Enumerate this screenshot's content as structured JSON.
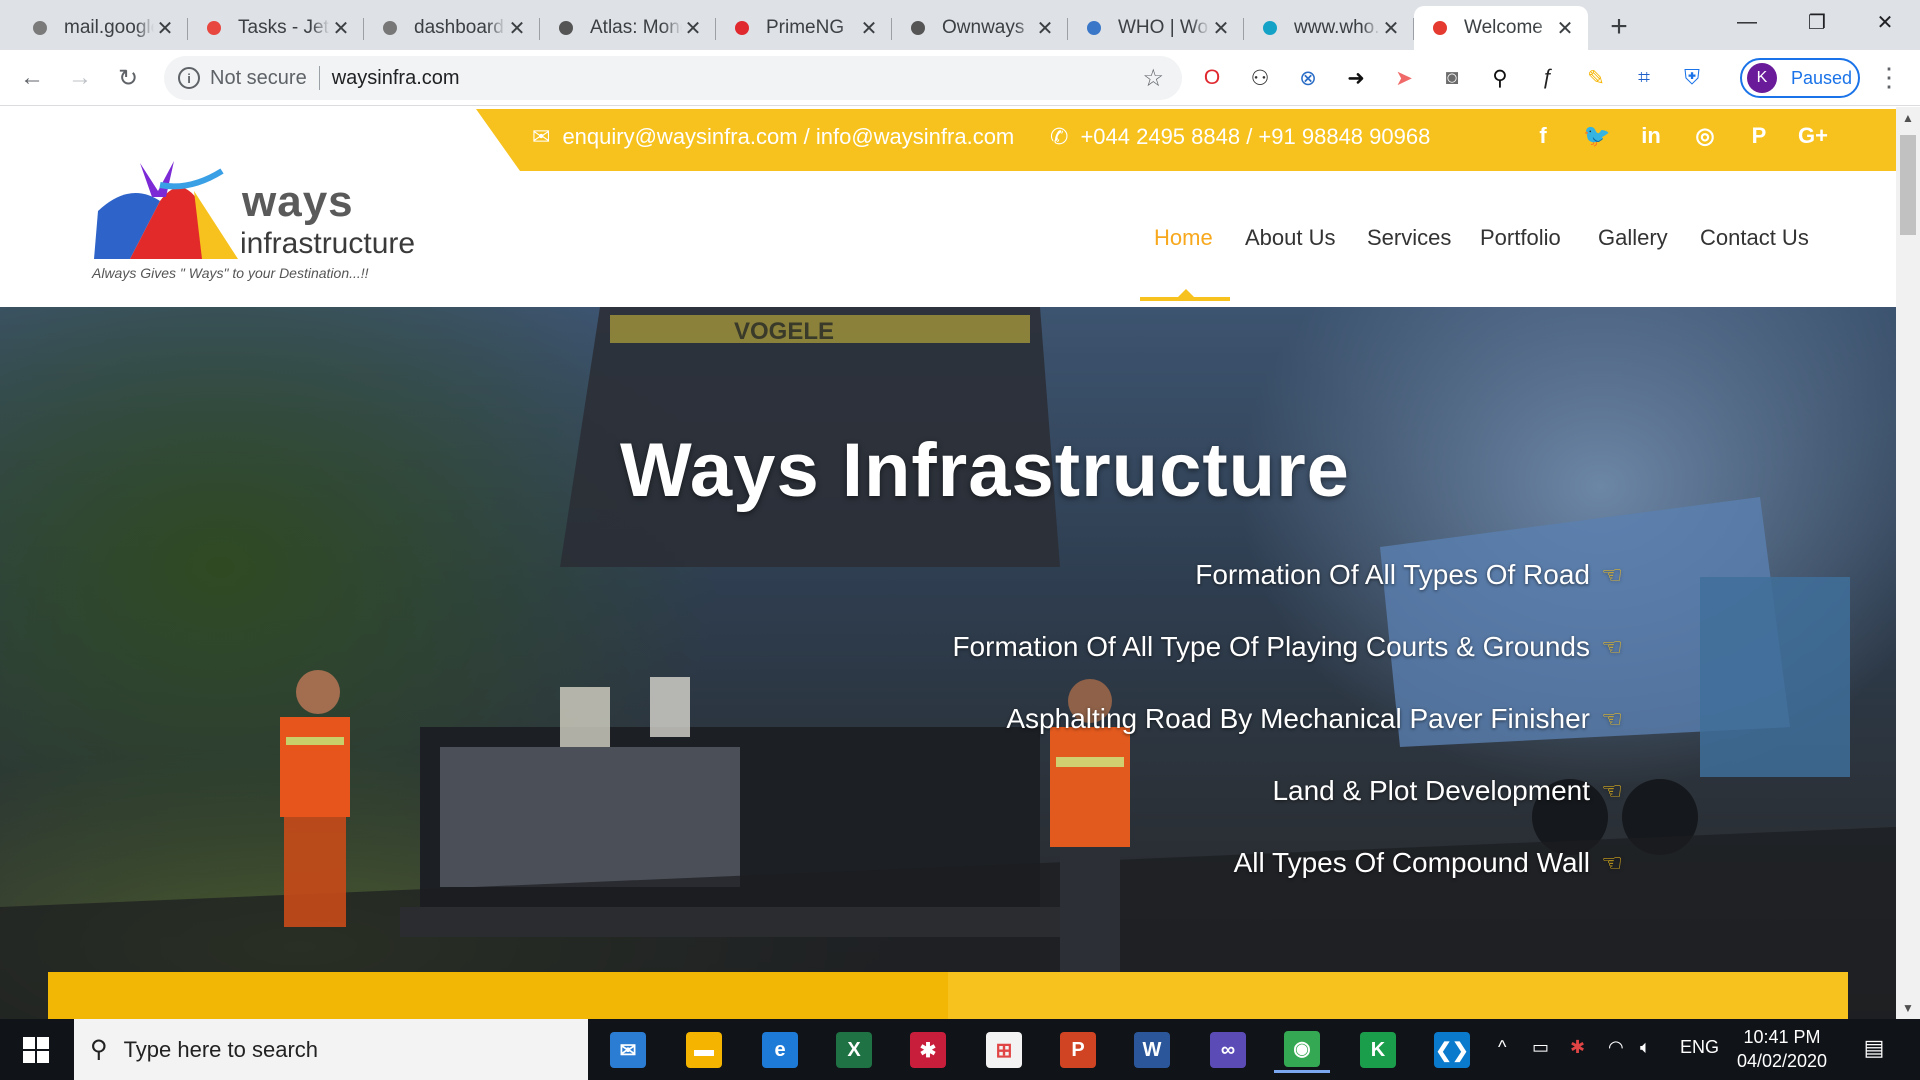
{
  "browser": {
    "tabs": [
      {
        "title": "mail.google.com",
        "icon": "gmail-icon",
        "color": "#7a7a7a"
      },
      {
        "title": "Tasks - JetBrains",
        "icon": "jetbrains-icon",
        "color": "#e8473f"
      },
      {
        "title": "dashboard",
        "icon": "h-icon",
        "color": "#777777"
      },
      {
        "title": "Atlas: MongoDB",
        "icon": "globe-icon",
        "color": "#555555"
      },
      {
        "title": "PrimeNG",
        "icon": "shield-icon",
        "color": "#e0282f"
      },
      {
        "title": "Ownways",
        "icon": "globe-icon",
        "color": "#555555"
      },
      {
        "title": "WHO | World",
        "icon": "who-icon",
        "color": "#3a77c8"
      },
      {
        "title": "www.who.int",
        "icon": "square-icon",
        "color": "#14a3c7"
      },
      {
        "title": "Welcome",
        "icon": "ways-logo-icon",
        "color": "#e43a2f"
      }
    ],
    "new_tab": "+",
    "window_controls": {
      "minimize": "—",
      "restore": "❐",
      "close": "✕"
    },
    "nav": {
      "back": "←",
      "forward": "→",
      "reload": "↻"
    },
    "security_label": "Not secure",
    "url": "waysinfra.com",
    "bookmark_star": "☆",
    "extensions": [
      {
        "name": "opera-icon",
        "glyph": "O",
        "color": "#e0282f"
      },
      {
        "name": "binoculars-icon",
        "glyph": "⚇",
        "color": "#333333"
      },
      {
        "name": "blocker-icon",
        "glyph": "⊗",
        "color": "#2a6dc7"
      },
      {
        "name": "arrow-icon",
        "glyph": "➜",
        "color": "#111111"
      },
      {
        "name": "cast-icon",
        "glyph": "➤",
        "color": "#f06a6a"
      },
      {
        "name": "camera-icon",
        "glyph": "◙",
        "color": "#6b6b6b"
      },
      {
        "name": "zoom-icon",
        "glyph": "⚲",
        "color": "#111111"
      },
      {
        "name": "font-icon",
        "glyph": "ƒ",
        "color": "#222222"
      },
      {
        "name": "pencil-icon",
        "glyph": "✎",
        "color": "#f5b400"
      },
      {
        "name": "crop-icon",
        "glyph": "⌗",
        "color": "#1f5fc9"
      },
      {
        "name": "shield-check-icon",
        "glyph": "⛨",
        "color": "#1a73e8"
      }
    ],
    "profile": {
      "initial": "K",
      "label": "Paused"
    },
    "menu": "⋮"
  },
  "site": {
    "email": "enquiry@waysinfra.com / info@waysinfra.com",
    "phone": "+044 2495 8848 / +91 98848 90968",
    "social": [
      {
        "name": "facebook-icon",
        "glyph": "f"
      },
      {
        "name": "twitter-icon",
        "glyph": "🐦"
      },
      {
        "name": "linkedin-icon",
        "glyph": "in"
      },
      {
        "name": "instagram-icon",
        "glyph": "◎"
      },
      {
        "name": "pinterest-icon",
        "glyph": "P"
      },
      {
        "name": "googleplus-icon",
        "glyph": "G+"
      }
    ],
    "logo": {
      "brand1": "ways",
      "brand2": "infrastructure",
      "tagline": "Always Gives \" Ways\" to your Destination...!!"
    },
    "nav": [
      "Home",
      "About Us",
      "Services",
      "Portfolio",
      "Gallery",
      "Contact Us"
    ],
    "active_nav": "Home",
    "accent_color": "#f7c21d",
    "hero": {
      "title": "Ways Infrastructure",
      "machine_brand": "VOGELE",
      "services": [
        "Formation Of All Types Of Road",
        "Formation Of All Type Of Playing Courts & Grounds",
        "Asphalting Road By Mechanical Paver Finisher",
        "Land & Plot Development",
        "All Types Of Compound Wall"
      ]
    }
  },
  "taskbar": {
    "search_placeholder": "Type here to search",
    "apps": [
      {
        "name": "mail-app-icon",
        "glyph": "✉",
        "bg": "#2b7cd3",
        "running": false
      },
      {
        "name": "file-explorer-icon",
        "glyph": "▬",
        "bg": "#f4b400",
        "running": false
      },
      {
        "name": "edge-icon",
        "glyph": "e",
        "bg": "#1e7ad7",
        "running": false
      },
      {
        "name": "excel-icon",
        "glyph": "X",
        "bg": "#1f7244",
        "running": false
      },
      {
        "name": "paint-app-icon",
        "glyph": "✱",
        "bg": "#c81e3c",
        "running": false
      },
      {
        "name": "store-icon",
        "glyph": "⊞",
        "bg": "#f3f3f3",
        "running": false
      },
      {
        "name": "powerpoint-icon",
        "glyph": "P",
        "bg": "#d04423",
        "running": false
      },
      {
        "name": "word-icon",
        "glyph": "W",
        "bg": "#2b579a",
        "running": false
      },
      {
        "name": "infinity-app-icon",
        "glyph": "∞",
        "bg": "#5b4bb7",
        "running": false
      },
      {
        "name": "chrome-icon",
        "glyph": "◉",
        "bg": "#34a853",
        "running": true
      },
      {
        "name": "kotlin-app-icon",
        "glyph": "K",
        "bg": "#1b9e4b",
        "running": false
      },
      {
        "name": "vscode-icon",
        "glyph": "❮❯",
        "bg": "#0a7acc",
        "running": false
      }
    ],
    "tray": {
      "chevron": "^",
      "language": "ENG"
    },
    "time": "10:41 PM",
    "date": "04/02/2020"
  }
}
